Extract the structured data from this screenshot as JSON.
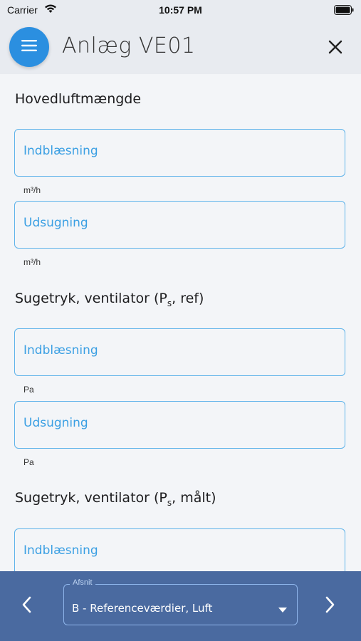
{
  "status_bar": {
    "carrier": "Carrier",
    "time": "10:57 PM"
  },
  "header": {
    "title": "Anlæg VE01",
    "menu_icon": "hamburger-menu-icon",
    "close_icon": "close-icon"
  },
  "sections": [
    {
      "title": "Hovedluftmængde",
      "fields": [
        {
          "label": "Indblæsning",
          "unit": "m³/h"
        },
        {
          "label": "Udsugning",
          "unit": "m³/h"
        }
      ]
    },
    {
      "title": "Sugetryk, ventilator (P",
      "title_sub": "s",
      "title_end": ", ref)",
      "fields": [
        {
          "label": "Indblæsning",
          "unit": "Pa"
        },
        {
          "label": "Udsugning",
          "unit": "Pa"
        }
      ]
    },
    {
      "title": "Sugetryk, ventilator (P",
      "title_sub": "s",
      "title_end": ", målt)",
      "fields": [
        {
          "label": "Indblæsning"
        }
      ]
    }
  ],
  "bottom_bar": {
    "select_legend": "Afsnit",
    "select_value": "B - Referenceværdier, Luft",
    "prev_icon": "chevron-left-icon",
    "next_icon": "chevron-right-icon"
  },
  "colors": {
    "accent": "#2b8fe0",
    "field_border": "#5fb3ea",
    "field_label": "#3a9fe3",
    "bottom_bar": "#4a6aa0"
  }
}
